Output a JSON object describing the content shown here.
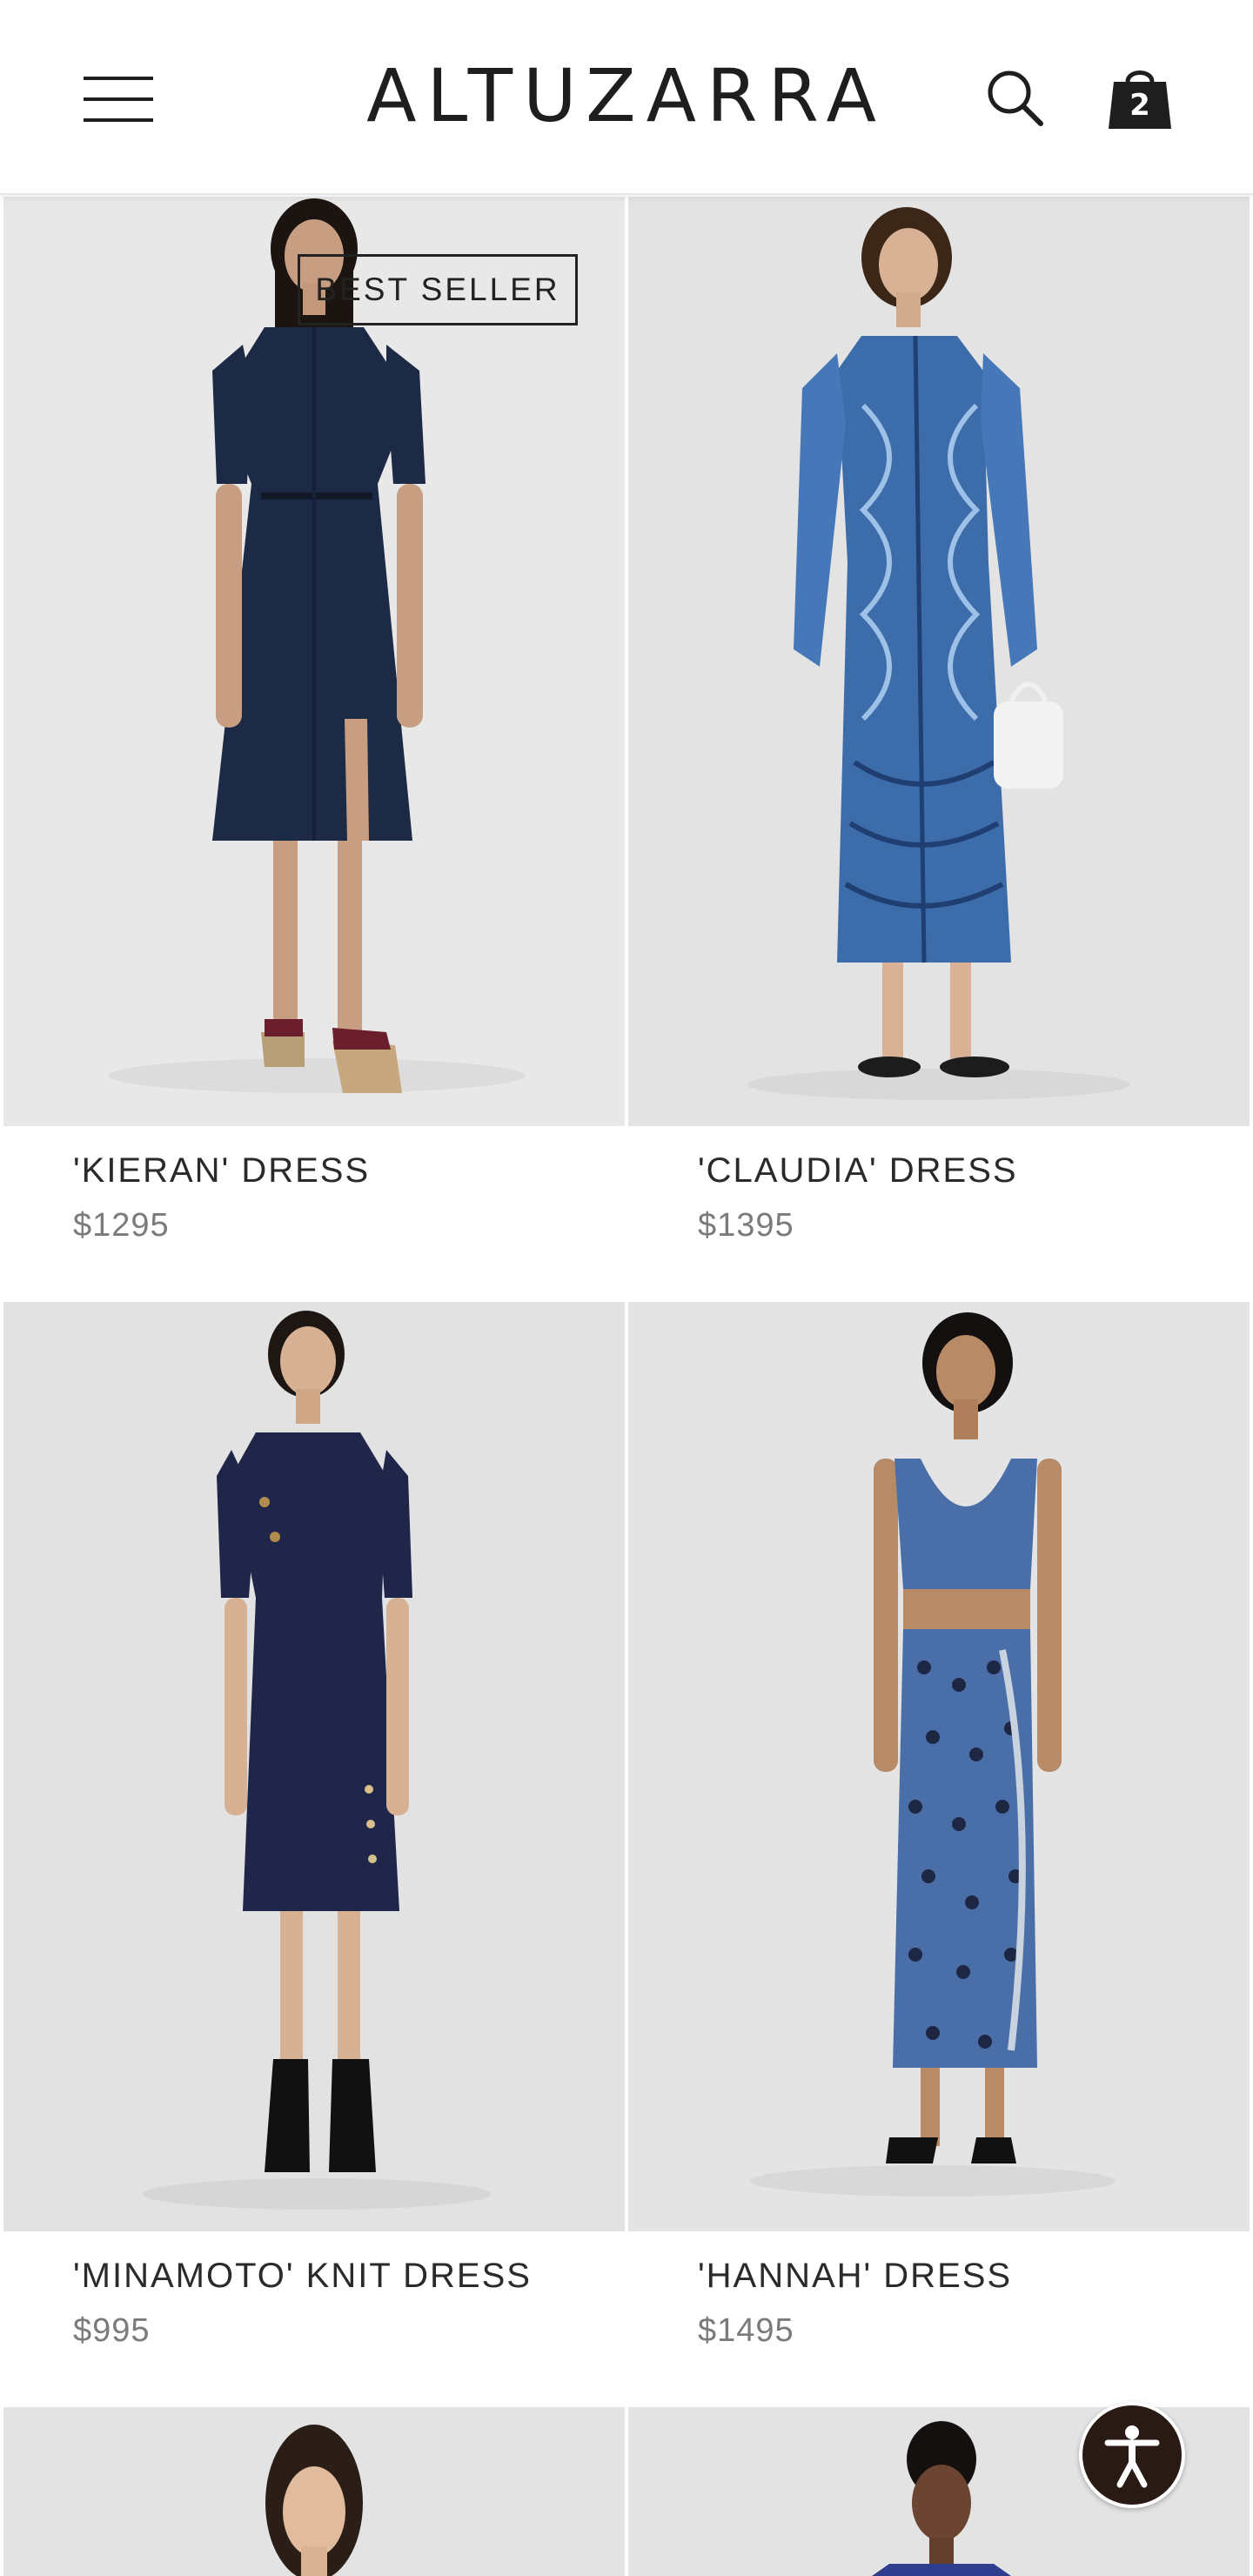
{
  "header": {
    "brand": "ALTUZARRA",
    "menu_icon": "hamburger-menu-icon",
    "search_icon": "search-icon",
    "bag_icon": "shopping-bag-icon",
    "bag_count": "2"
  },
  "products": [
    {
      "name": "'KIERAN' DRESS",
      "price": "$1295",
      "badge": "BEST SELLER",
      "image": "model in navy denim shirt dress with belt and lace-up espadrille wedges",
      "garment_color": "#1d2a45"
    },
    {
      "name": "'CLAUDIA' DRESS",
      "price": "$1395",
      "image": "model in blue printed long-sleeve shirt dress holding a white bag",
      "garment_color": "#3d6cab"
    },
    {
      "name": "'MINAMOTO' KNIT DRESS",
      "price": "$995",
      "image": "model in navy asymmetric button knit dress with black boots",
      "garment_color": "#20264a"
    },
    {
      "name": "'HANNAH' DRESS",
      "price": "$1495",
      "image": "model in blue patterned cut-out knit maxi dress with slingback heels",
      "garment_color": "#4a6ea8"
    },
    {
      "name": "",
      "price": "",
      "image": "model with bob haircut",
      "garment_color": "#cfcfcf"
    },
    {
      "name": "",
      "price": "",
      "image": "model in blue top",
      "garment_color": "#2f3e8f"
    }
  ],
  "accessibility": {
    "icon": "accessibility-icon"
  },
  "colors": {
    "photo_background": "#e6e6e6",
    "text_primary": "#2a2a2a",
    "text_price": "#7b7b7b",
    "accessibility_button": "#2a1a14"
  }
}
